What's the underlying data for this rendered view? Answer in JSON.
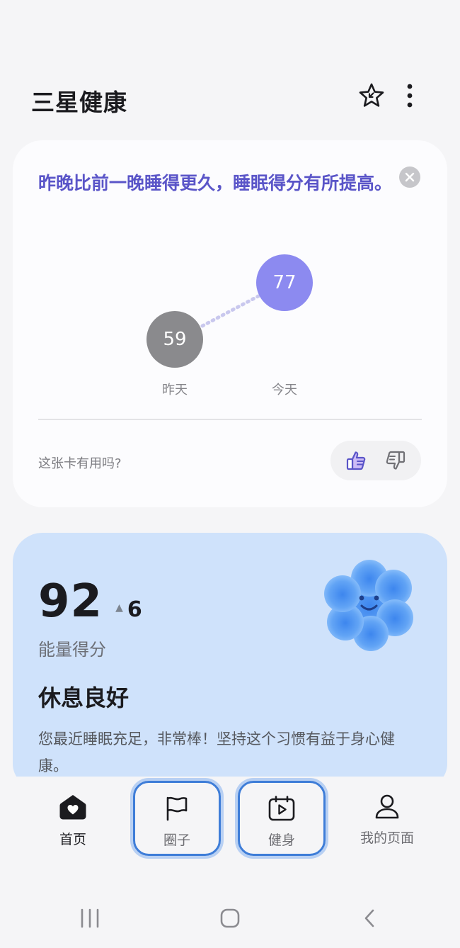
{
  "header": {
    "title": "三星健康",
    "star_icon": "star-pin-icon",
    "more_icon": "more-vertical-icon"
  },
  "sleep_card": {
    "message": "昨晚比前一晚睡得更久，睡眠得分有所提高。",
    "yesterday": {
      "value": "59",
      "label": "昨天"
    },
    "today": {
      "value": "77",
      "label": "今天"
    },
    "feedback_question": "这张卡有用吗?",
    "colors": {
      "accent": "#5a55c8",
      "today_bubble": "#8c8af0",
      "yesterday_bubble": "#8a8a8d"
    }
  },
  "energy_card": {
    "score": "92",
    "delta": "6",
    "delta_direction": "up",
    "score_label": "能量得分",
    "status_title": "休息良好",
    "description": "您最近睡眠充足，非常棒！坚持这个习惯有益于身心健康。",
    "colors": {
      "background": "#cfe2fb",
      "mascot": "#5b9cf0"
    }
  },
  "bottom_nav": {
    "items": [
      {
        "label": "首页",
        "icon": "home-heart-icon",
        "active": true
      },
      {
        "label": "圈子",
        "icon": "flag-icon",
        "focused": true
      },
      {
        "label": "健身",
        "icon": "calendar-play-icon",
        "focused": true
      },
      {
        "label": "我的页面",
        "icon": "person-icon"
      }
    ],
    "focus_color": "#3e7dd8"
  },
  "system_nav": {
    "recents_icon": "recents-icon",
    "home_icon": "home-button-icon",
    "back_icon": "back-icon"
  }
}
